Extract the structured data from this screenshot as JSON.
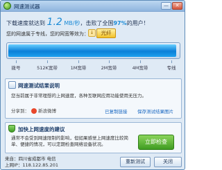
{
  "window": {
    "title": "网速测试器",
    "minimize_glyph": "—",
    "close_glyph": "✕"
  },
  "result": {
    "prefix": "下载速度就达到",
    "speed": "1.2",
    "unit": "MB/秒",
    "middle": "，击败了全国",
    "percent": "97%",
    "suffix": "的用户！"
  },
  "bandwidth": {
    "text": "您的网速属于专线，您的网宽等效为：",
    "icon_glyph": "↓",
    "badge": "光纤"
  },
  "gauge": {
    "fill_fraction": 0.98,
    "labels": [
      "拨号",
      "512K宽带",
      "1M宽带",
      "2M宽带",
      "4M宽带",
      "专线"
    ]
  },
  "share_section": {
    "title": "网速测试结果说明",
    "text": "您当前属于非常理想的上网速度，各种互联网应用功能使用无压力。",
    "share_label": "分享到：",
    "weibo_label": "新浪微博",
    "copy_link": "已复制链接",
    "save_link": "保存测试结果图片"
  },
  "boost_section": {
    "title": "加快上网速度的建议",
    "text": "通常不会受到网速限制的影响，但如果感觉上网速度比较简单、便捷的情况，可以定期检查网络设备状况。",
    "button": "立即检查"
  },
  "footer": {
    "location": "来自：四川省成都市 电信",
    "ip": "上网IP：118.122.85.201",
    "retest": "重新测试",
    "close": "关闭"
  },
  "colors": {
    "accent": "#1a8ad6",
    "gauge_fill": "#0a7fd8",
    "boost_button": "#3f9c22"
  }
}
